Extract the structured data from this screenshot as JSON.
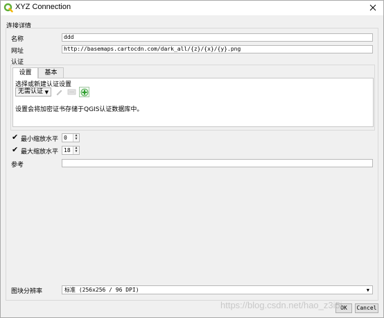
{
  "window": {
    "title": "XYZ Connection"
  },
  "group": {
    "title": "连接详情"
  },
  "name": {
    "label": "名称",
    "value": "ddd"
  },
  "url": {
    "label": "网址",
    "value": "http://basemaps.cartocdn.com/dark_all/{z}/{x}/{y}.png"
  },
  "auth": {
    "label": "认证",
    "tabs": [
      {
        "label": "设置"
      },
      {
        "label": "基本"
      }
    ],
    "select_prompt": "选择或新建认证设置",
    "config_value": "无需认证",
    "info": "设置会将加密证书存储于QGIS认证数据库中。"
  },
  "zoom_min": {
    "label": "最小缩放水平",
    "value": "0",
    "checked": true
  },
  "zoom_max": {
    "label": "最大缩放水平",
    "value": "18",
    "checked": true
  },
  "referer": {
    "label": "参考",
    "value": ""
  },
  "resolution": {
    "label": "图块分辨率",
    "value": "标准 (256x256 / 96 DPI)"
  },
  "buttons": {
    "ok": "OK",
    "cancel": "Cancel"
  },
  "watermark": "https://blog.csdn.net/hao_z3i5i",
  "colors": {
    "qgis_green": "#5fae36",
    "plus_green": "#2f9e2f"
  }
}
